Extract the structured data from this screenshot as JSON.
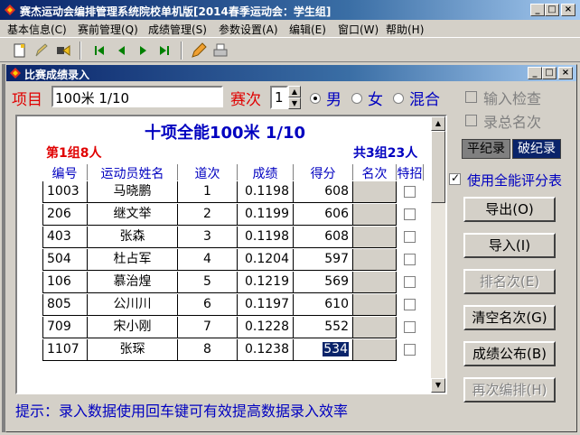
{
  "window": {
    "title": "赛杰运动会编排管理系统院校单机版[2014春季运动会：学生组]",
    "minimize": "_",
    "maximize": "□",
    "close": "×"
  },
  "menu": [
    "基本信息(C)",
    "赛前管理(Q)",
    "成绩管理(S)",
    "参数设置(A)",
    "编辑(E)",
    "窗口(W)",
    "帮助(H)"
  ],
  "toolbar_icons": [
    "new-doc-icon",
    "edit-icon",
    "exit-icon",
    "first-icon",
    "prev-icon",
    "next-icon",
    "last-icon",
    "pencil-icon",
    "print-icon"
  ],
  "child": {
    "title": "比赛成绩录入",
    "minimize": "_",
    "maximize": "□",
    "close": "×"
  },
  "form": {
    "event_label": "项目",
    "event_value": "100米  1/10",
    "round_label": "赛次",
    "round_value": "1",
    "gender_options": [
      "男",
      "女",
      "混合"
    ],
    "gender_selected": "男"
  },
  "checks": {
    "input_check": "输入检查",
    "record_total": "录总名次",
    "use_scoring": "使用全能评分表"
  },
  "records": {
    "normal": "平纪录",
    "broken": "破纪录"
  },
  "buttons": {
    "export": "导出(O)",
    "import": "导入(I)",
    "rank": "排名次(E)",
    "clear": "清空名次(G)",
    "publish": "成绩公布(B)",
    "rearrange": "再次编排(H)"
  },
  "grid": {
    "title": "十项全能100米   1/10",
    "group": "第1组8人",
    "total": "共3组23人",
    "columns": [
      "编号",
      "运动员姓名",
      "道次",
      "成绩",
      "得分",
      "名次",
      "特招"
    ],
    "rows": [
      [
        "1003",
        "马晓鹏",
        "1",
        "0.1198",
        "608"
      ],
      [
        "206",
        "继文举",
        "2",
        "0.1199",
        "606"
      ],
      [
        "403",
        "张森",
        "3",
        "0.1198",
        "608"
      ],
      [
        "504",
        "杜占军",
        "4",
        "0.1204",
        "597"
      ],
      [
        "106",
        "慕治煌",
        "5",
        "0.1219",
        "569"
      ],
      [
        "805",
        "公川川",
        "6",
        "0.1197",
        "610"
      ],
      [
        "709",
        "宋小刚",
        "7",
        "0.1228",
        "552"
      ],
      [
        "1107",
        "张琛",
        "8",
        "0.1238",
        "534"
      ]
    ]
  },
  "hint": "提示：录入数据使用回车键可有效提高数据录入效率",
  "colors": {
    "accent": "#0000c0",
    "red": "#e00000",
    "title_bar": "#0a246a",
    "record_broken_bg": "#0a246a"
  }
}
